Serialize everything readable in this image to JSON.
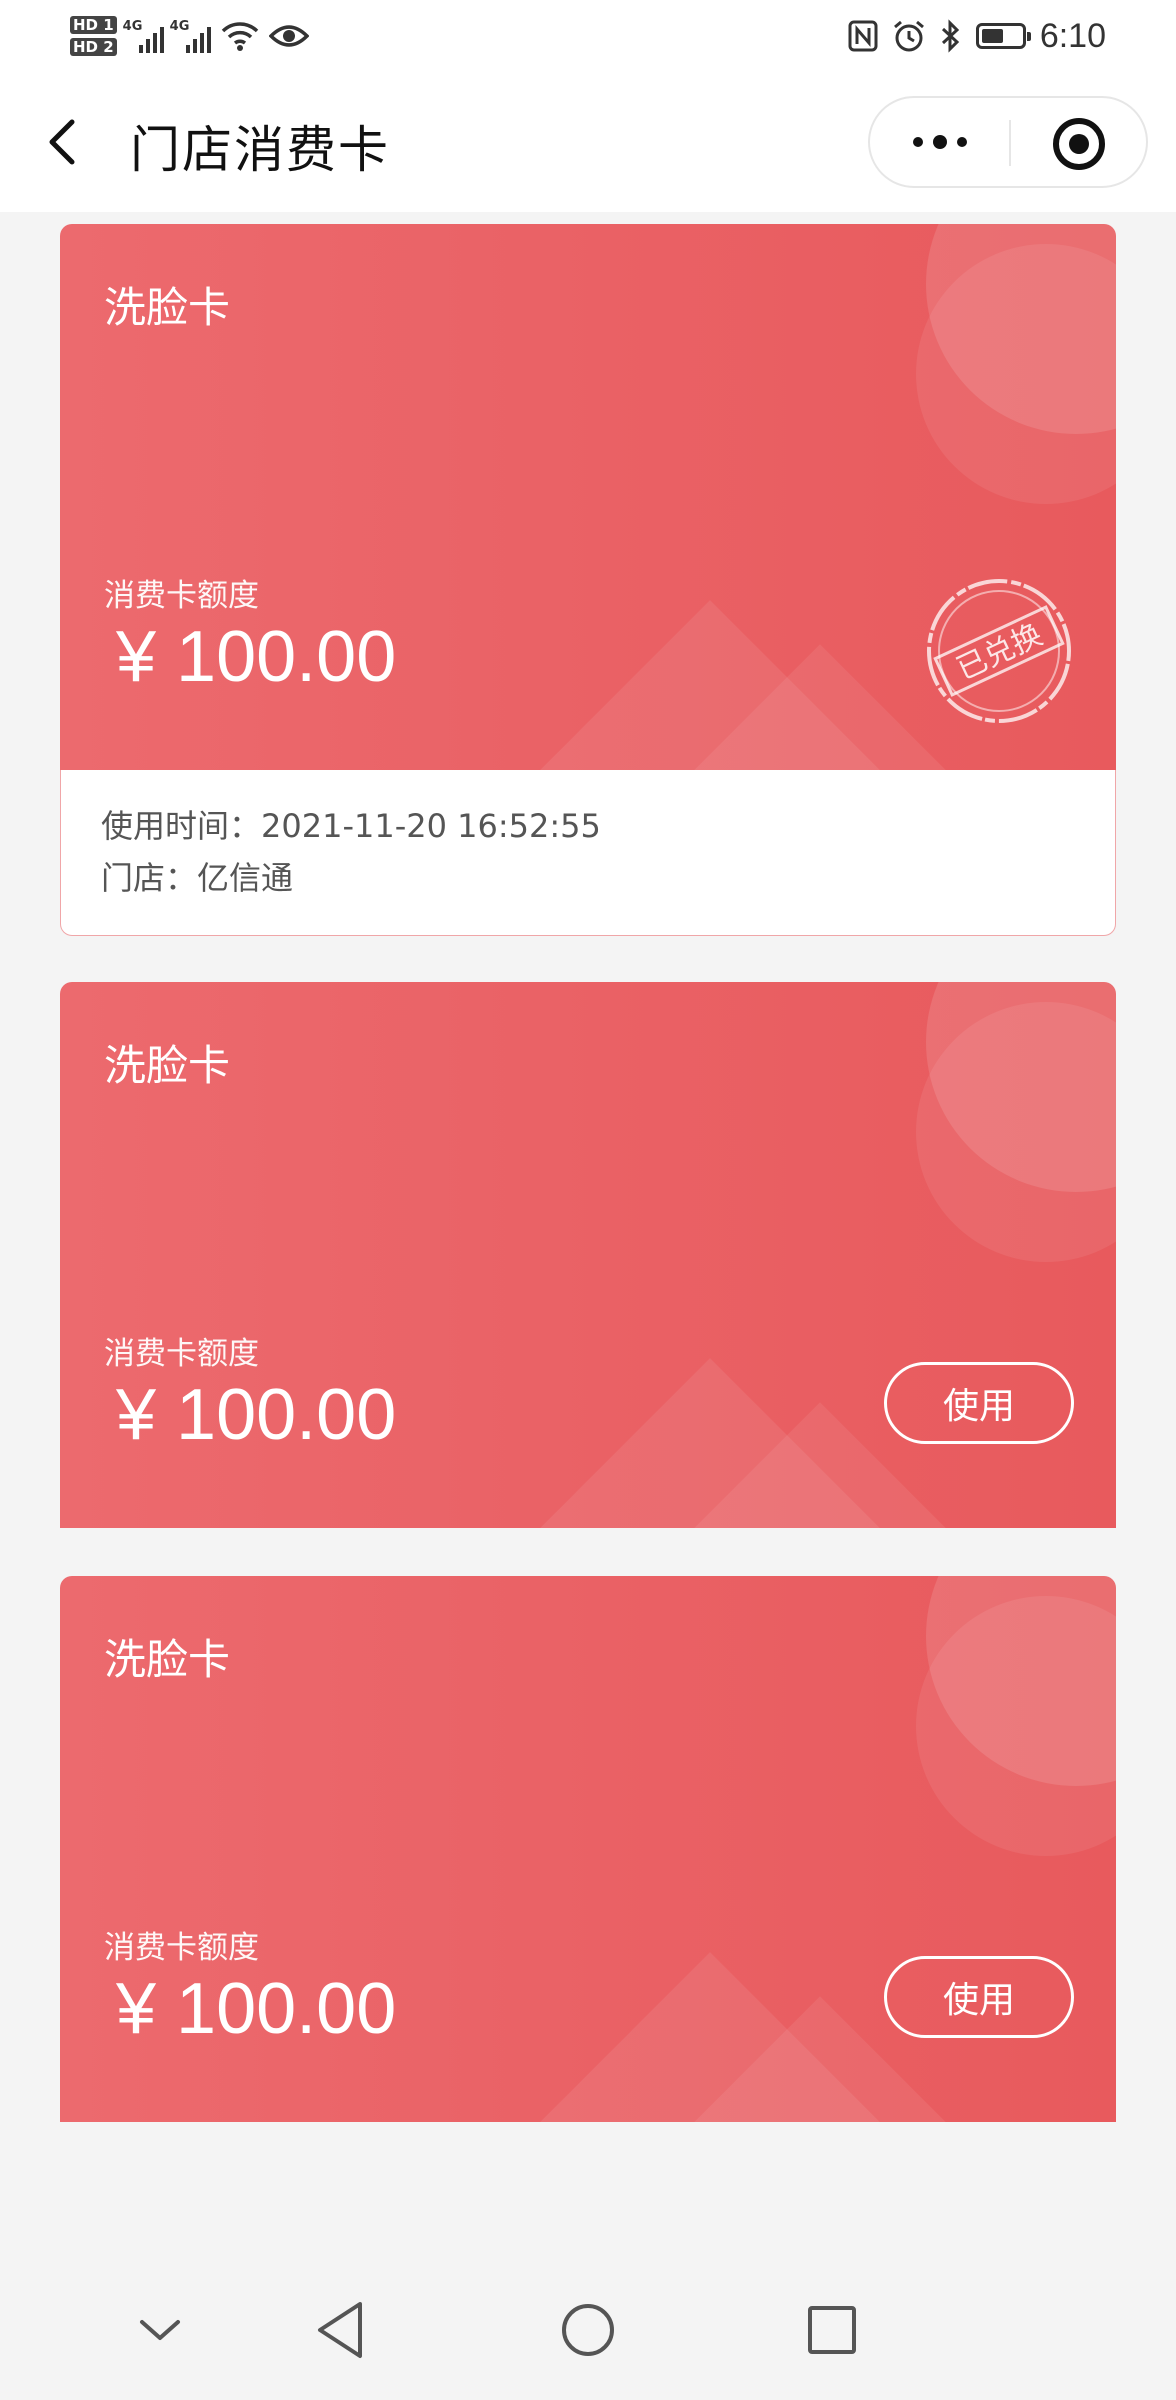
{
  "status_bar": {
    "time": "6:10",
    "sim1": "HD 1",
    "sim2": "HD 2",
    "net1": "4G",
    "net2": "4G",
    "battery_level": 0.55
  },
  "nav": {
    "title": "门店消费卡"
  },
  "cards": [
    {
      "name": "洗脸卡",
      "label": "消费卡额度",
      "amount": "¥ 100.00",
      "status": "已兑换",
      "use_time": "使用时间：2021-11-20 16:52:55",
      "store": "门店：亿信通"
    },
    {
      "name": "洗脸卡",
      "label": "消费卡额度",
      "amount": "¥ 100.00",
      "action": "使用"
    },
    {
      "name": "洗脸卡",
      "label": "消费卡额度",
      "amount": "¥ 100.00",
      "action": "使用"
    }
  ],
  "colors": {
    "card": "#ea6266",
    "background": "#f4f4f4"
  }
}
